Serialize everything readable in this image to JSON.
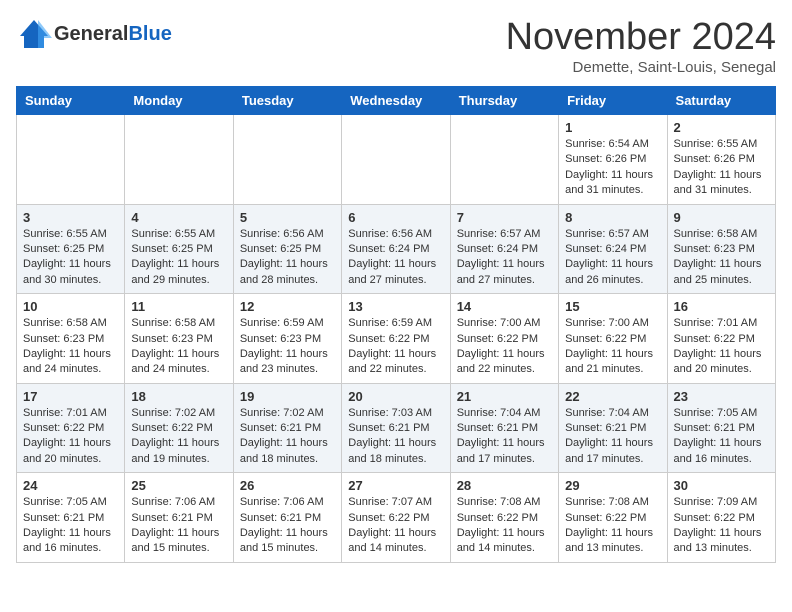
{
  "header": {
    "logo_general": "General",
    "logo_blue": "Blue",
    "month_title": "November 2024",
    "location": "Demette, Saint-Louis, Senegal"
  },
  "days_of_week": [
    "Sunday",
    "Monday",
    "Tuesday",
    "Wednesday",
    "Thursday",
    "Friday",
    "Saturday"
  ],
  "weeks": [
    [
      {
        "day": "",
        "info": ""
      },
      {
        "day": "",
        "info": ""
      },
      {
        "day": "",
        "info": ""
      },
      {
        "day": "",
        "info": ""
      },
      {
        "day": "",
        "info": ""
      },
      {
        "day": "1",
        "info": "Sunrise: 6:54 AM\nSunset: 6:26 PM\nDaylight: 11 hours and 31 minutes."
      },
      {
        "day": "2",
        "info": "Sunrise: 6:55 AM\nSunset: 6:26 PM\nDaylight: 11 hours and 31 minutes."
      }
    ],
    [
      {
        "day": "3",
        "info": "Sunrise: 6:55 AM\nSunset: 6:25 PM\nDaylight: 11 hours and 30 minutes."
      },
      {
        "day": "4",
        "info": "Sunrise: 6:55 AM\nSunset: 6:25 PM\nDaylight: 11 hours and 29 minutes."
      },
      {
        "day": "5",
        "info": "Sunrise: 6:56 AM\nSunset: 6:25 PM\nDaylight: 11 hours and 28 minutes."
      },
      {
        "day": "6",
        "info": "Sunrise: 6:56 AM\nSunset: 6:24 PM\nDaylight: 11 hours and 27 minutes."
      },
      {
        "day": "7",
        "info": "Sunrise: 6:57 AM\nSunset: 6:24 PM\nDaylight: 11 hours and 27 minutes."
      },
      {
        "day": "8",
        "info": "Sunrise: 6:57 AM\nSunset: 6:24 PM\nDaylight: 11 hours and 26 minutes."
      },
      {
        "day": "9",
        "info": "Sunrise: 6:58 AM\nSunset: 6:23 PM\nDaylight: 11 hours and 25 minutes."
      }
    ],
    [
      {
        "day": "10",
        "info": "Sunrise: 6:58 AM\nSunset: 6:23 PM\nDaylight: 11 hours and 24 minutes."
      },
      {
        "day": "11",
        "info": "Sunrise: 6:58 AM\nSunset: 6:23 PM\nDaylight: 11 hours and 24 minutes."
      },
      {
        "day": "12",
        "info": "Sunrise: 6:59 AM\nSunset: 6:23 PM\nDaylight: 11 hours and 23 minutes."
      },
      {
        "day": "13",
        "info": "Sunrise: 6:59 AM\nSunset: 6:22 PM\nDaylight: 11 hours and 22 minutes."
      },
      {
        "day": "14",
        "info": "Sunrise: 7:00 AM\nSunset: 6:22 PM\nDaylight: 11 hours and 22 minutes."
      },
      {
        "day": "15",
        "info": "Sunrise: 7:00 AM\nSunset: 6:22 PM\nDaylight: 11 hours and 21 minutes."
      },
      {
        "day": "16",
        "info": "Sunrise: 7:01 AM\nSunset: 6:22 PM\nDaylight: 11 hours and 20 minutes."
      }
    ],
    [
      {
        "day": "17",
        "info": "Sunrise: 7:01 AM\nSunset: 6:22 PM\nDaylight: 11 hours and 20 minutes."
      },
      {
        "day": "18",
        "info": "Sunrise: 7:02 AM\nSunset: 6:22 PM\nDaylight: 11 hours and 19 minutes."
      },
      {
        "day": "19",
        "info": "Sunrise: 7:02 AM\nSunset: 6:21 PM\nDaylight: 11 hours and 18 minutes."
      },
      {
        "day": "20",
        "info": "Sunrise: 7:03 AM\nSunset: 6:21 PM\nDaylight: 11 hours and 18 minutes."
      },
      {
        "day": "21",
        "info": "Sunrise: 7:04 AM\nSunset: 6:21 PM\nDaylight: 11 hours and 17 minutes."
      },
      {
        "day": "22",
        "info": "Sunrise: 7:04 AM\nSunset: 6:21 PM\nDaylight: 11 hours and 17 minutes."
      },
      {
        "day": "23",
        "info": "Sunrise: 7:05 AM\nSunset: 6:21 PM\nDaylight: 11 hours and 16 minutes."
      }
    ],
    [
      {
        "day": "24",
        "info": "Sunrise: 7:05 AM\nSunset: 6:21 PM\nDaylight: 11 hours and 16 minutes."
      },
      {
        "day": "25",
        "info": "Sunrise: 7:06 AM\nSunset: 6:21 PM\nDaylight: 11 hours and 15 minutes."
      },
      {
        "day": "26",
        "info": "Sunrise: 7:06 AM\nSunset: 6:21 PM\nDaylight: 11 hours and 15 minutes."
      },
      {
        "day": "27",
        "info": "Sunrise: 7:07 AM\nSunset: 6:22 PM\nDaylight: 11 hours and 14 minutes."
      },
      {
        "day": "28",
        "info": "Sunrise: 7:08 AM\nSunset: 6:22 PM\nDaylight: 11 hours and 14 minutes."
      },
      {
        "day": "29",
        "info": "Sunrise: 7:08 AM\nSunset: 6:22 PM\nDaylight: 11 hours and 13 minutes."
      },
      {
        "day": "30",
        "info": "Sunrise: 7:09 AM\nSunset: 6:22 PM\nDaylight: 11 hours and 13 minutes."
      }
    ]
  ]
}
